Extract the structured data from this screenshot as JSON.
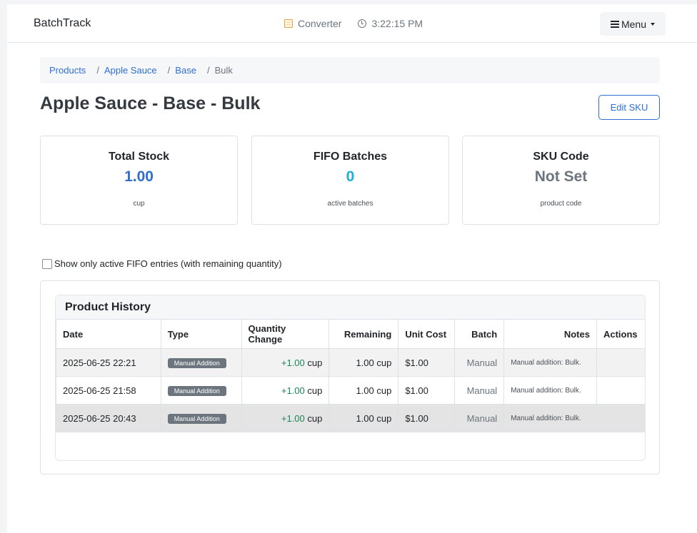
{
  "navbar": {
    "brand": "BatchTrack",
    "converter_label": "Converter",
    "time": "3:22:15 PM",
    "menu_label": "Menu"
  },
  "breadcrumb": {
    "items": [
      "Products",
      "Apple Sauce",
      "Base"
    ],
    "current": "Bulk",
    "separator": "/"
  },
  "page": {
    "title": "Apple Sauce - Base - Bulk",
    "edit_button": "Edit SKU"
  },
  "cards": [
    {
      "title": "Total Stock",
      "value": "1.00",
      "sub": "cup",
      "color": "#2f6fd1"
    },
    {
      "title": "FIFO Batches",
      "value": "0",
      "sub": "active batches",
      "color": "#17b3d0"
    },
    {
      "title": "SKU Code",
      "value": "Not Set",
      "sub": "product code",
      "color": "#6c757d"
    }
  ],
  "filter": {
    "label": "Show only active FIFO entries (with remaining quantity)",
    "checked": false
  },
  "history": {
    "title": "Product History",
    "columns": [
      "Date",
      "Type",
      "Quantity Change",
      "Remaining",
      "Unit Cost",
      "Batch",
      "Notes",
      "Actions"
    ],
    "rows": [
      {
        "date": "2025-06-25 22:21",
        "type": "Manual Addition",
        "qty_value": "+1.00",
        "qty_unit": "cup",
        "remaining": "1.00 cup",
        "unit_cost": "$1.00",
        "batch": "Manual",
        "notes": "Manual addition: Bulk.",
        "actions": ""
      },
      {
        "date": "2025-06-25 21:58",
        "type": "Manual Addition",
        "qty_value": "+1.00",
        "qty_unit": "cup",
        "remaining": "1.00 cup",
        "unit_cost": "$1.00",
        "batch": "Manual",
        "notes": "Manual addition: Bulk.",
        "actions": ""
      },
      {
        "date": "2025-06-25 20:43",
        "type": "Manual Addition",
        "qty_value": "+1.00",
        "qty_unit": "cup",
        "remaining": "1.00 cup",
        "unit_cost": "$1.00",
        "batch": "Manual",
        "notes": "Manual addition: Bulk.",
        "actions": ""
      }
    ]
  },
  "colors": {
    "accent": "#2f6fd1",
    "positive": "#198754",
    "badge": "#6c757d"
  }
}
